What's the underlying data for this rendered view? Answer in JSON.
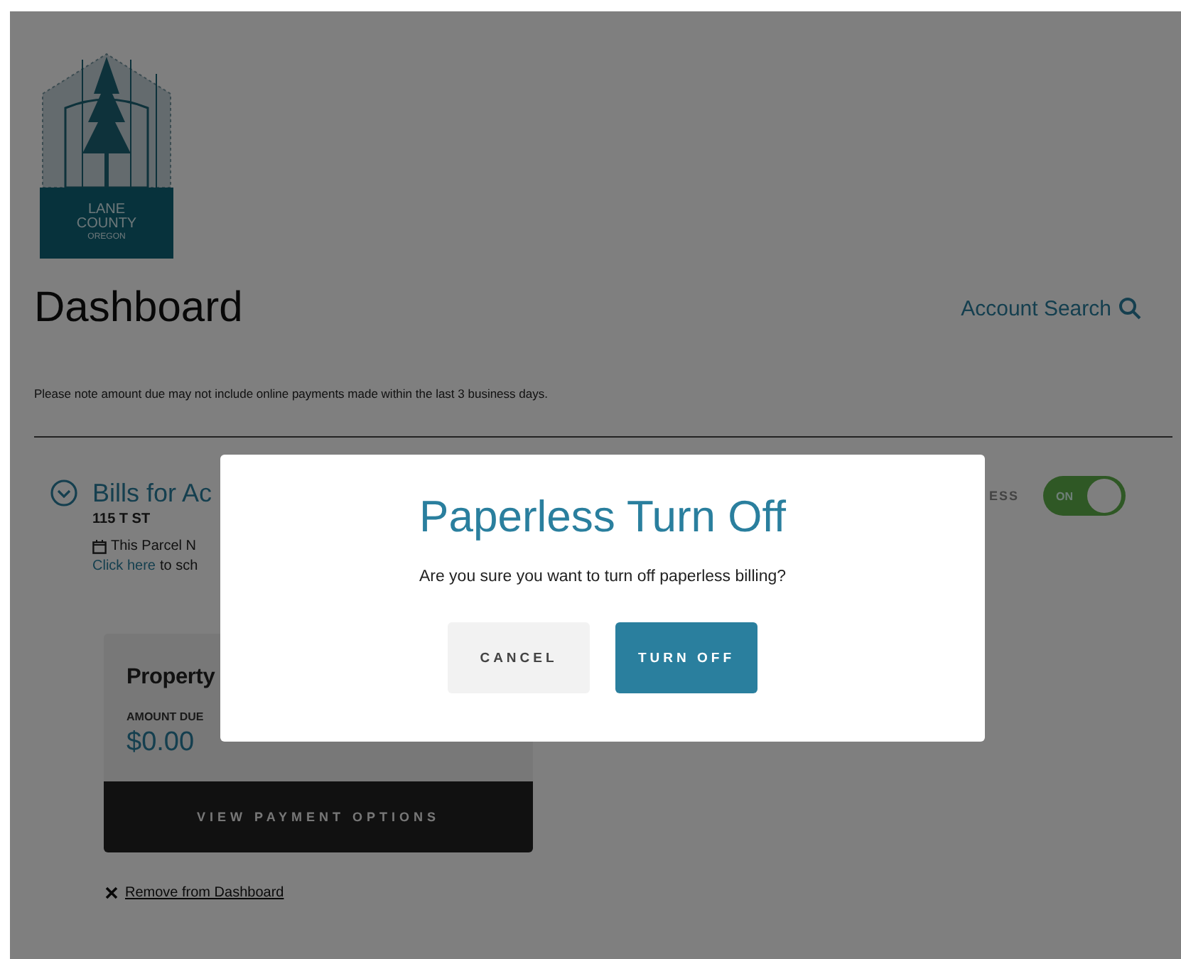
{
  "logo": {
    "lines": [
      "LANE",
      "COUNTY",
      "OREGON"
    ]
  },
  "page": {
    "title": "Dashboard",
    "account_search": "Account Search",
    "note": "Please note amount due may not include online payments made within the last 3 business days."
  },
  "bills": {
    "title": "Bills for Ac",
    "address": "115 T ST",
    "notice": "This Parcel N",
    "link": "Click here",
    "link_rest": "to sch"
  },
  "paperless": {
    "label": "ESS",
    "toggle_label": "ON",
    "on": true
  },
  "card": {
    "title": "Property",
    "amount_label": "AMOUNT DUE",
    "amount": "$0.00",
    "button": "VIEW PAYMENT OPTIONS"
  },
  "remove_link": "Remove from Dashboard",
  "dialog": {
    "title": "Paperless Turn Off",
    "message": "Are you sure you want to turn off paperless billing?",
    "buttons": [
      {
        "label": "CANCEL",
        "kind": "secondary"
      },
      {
        "label": "TURN OFF",
        "kind": "primary"
      }
    ]
  }
}
